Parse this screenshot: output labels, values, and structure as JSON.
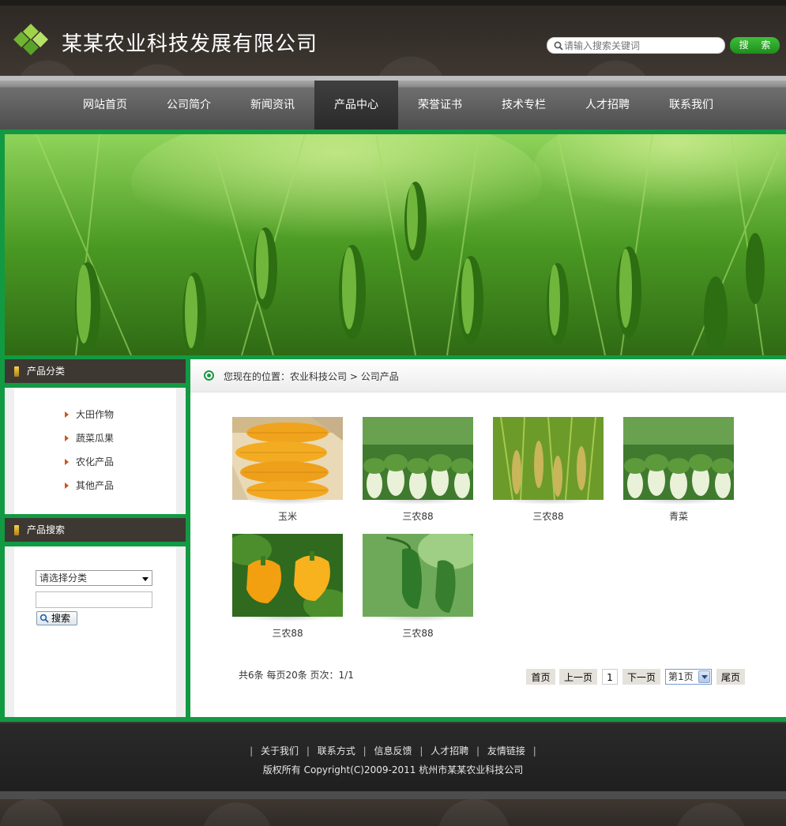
{
  "header": {
    "company_name": "某某农业科技发展有限公司",
    "search_placeholder": "请输入搜索关键词",
    "search_button": "搜 索"
  },
  "nav": {
    "items": [
      "网站首页",
      "公司简介",
      "新闻资讯",
      "产品中心",
      "荣誉证书",
      "技术专栏",
      "人才招聘",
      "联系我们"
    ],
    "active": "产品中心"
  },
  "sidebar": {
    "category_title": "产品分类",
    "categories": [
      "大田作物",
      "蔬菜瓜果",
      "农化产品",
      "其他产品"
    ],
    "search_title": "产品搜索",
    "select_placeholder": "请选择分类",
    "search_button": "搜索"
  },
  "breadcrumb": {
    "prefix": "您现在的位置：",
    "home": "农业科技公司",
    "separator": " > ",
    "current": "公司产品"
  },
  "products": [
    {
      "name": "玉米",
      "image": "corn"
    },
    {
      "name": "三农88",
      "image": "cabbage"
    },
    {
      "name": "三农88",
      "image": "rice"
    },
    {
      "name": "青菜",
      "image": "cabbage"
    },
    {
      "name": "三农88",
      "image": "yellow-pepper"
    },
    {
      "name": "三农88",
      "image": "green-pepper"
    }
  ],
  "pagination": {
    "info": "共6条  每页20条  页次：1/1",
    "first": "首页",
    "prev": "上一页",
    "current_page": "1",
    "next": "下一页",
    "page_select": "第1页",
    "last": "尾页"
  },
  "footer": {
    "links": [
      "关于我们",
      "联系方式",
      "信息反馈",
      "人才招聘",
      "友情链接"
    ],
    "copyright": "版权所有  Copyright(C)2009-2011 杭州市某某农业科技公司"
  },
  "colors": {
    "brand_green": "#129a43",
    "header_brown": "#3a342f",
    "nav_active": "#2f2f2f"
  }
}
